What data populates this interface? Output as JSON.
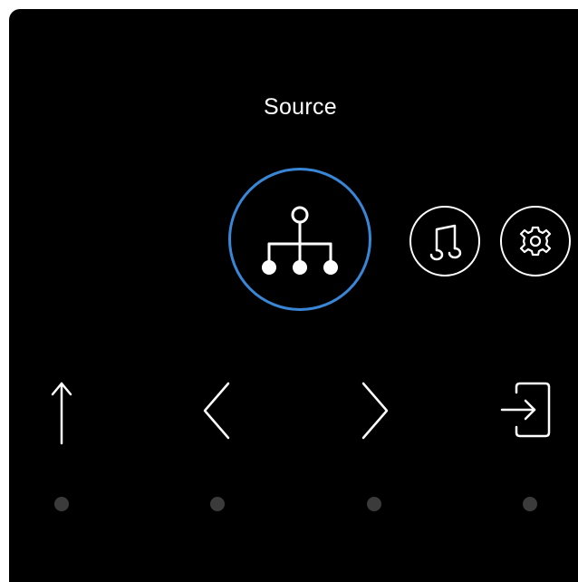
{
  "screen": {
    "title": "Source",
    "accent_color": "#3a86d6",
    "background": "#000000"
  },
  "menu_items": [
    {
      "name": "source",
      "icon": "network-tree-icon",
      "selected": true
    },
    {
      "name": "music",
      "icon": "music-note-icon",
      "selected": false
    },
    {
      "name": "settings",
      "icon": "gear-icon",
      "selected": false
    }
  ],
  "nav_buttons": [
    {
      "name": "up",
      "icon": "arrow-up-icon"
    },
    {
      "name": "previous",
      "icon": "chevron-left-icon"
    },
    {
      "name": "next",
      "icon": "chevron-right-icon"
    },
    {
      "name": "enter",
      "icon": "enter-icon"
    }
  ],
  "indicator_dot_color": "#3b3b3b"
}
